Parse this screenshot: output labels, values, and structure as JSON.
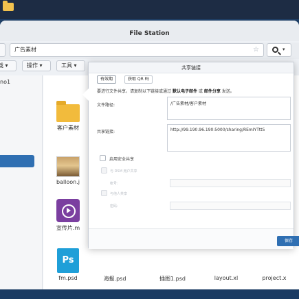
{
  "window": {
    "title": "File Station"
  },
  "pathbar": {
    "path": "广告素材"
  },
  "toolbar": {
    "btn1": "载 ▾",
    "btn2": "操作 ▾",
    "btn3": "工具 ▾"
  },
  "sidebar": {
    "label": "no1"
  },
  "files": [
    {
      "name": "客户素材",
      "kind": "folder"
    },
    {
      "name": "balloon.j",
      "kind": "photo"
    },
    {
      "name": "宣传片.m",
      "kind": "video"
    },
    {
      "name": "fm.psd",
      "kind": "psd"
    },
    {
      "name": "海报.psd",
      "kind": "psd"
    },
    {
      "name": "插图1.psd",
      "kind": "psd"
    },
    {
      "name": "layout.xl",
      "kind": "sheet"
    },
    {
      "name": "project.x",
      "kind": "sheet"
    }
  ],
  "icons": {
    "psd_glyph": "Ps",
    "star": "☆",
    "search_caret": "▾"
  },
  "dialog": {
    "title": "共享链接",
    "tab_valid": "有效期",
    "tab_qr": "获取 QR 码",
    "hint_pre": "要进行文件共享，请复制以下链接或通过",
    "hint_link1": "默认电子邮件",
    "hint_mid": "或",
    "hint_link2": "邮件分享",
    "hint_post": "发送。",
    "path_label": "文件路径:",
    "path_value": "/广告素材/客户素材",
    "link_label": "共享链接:",
    "link_value": "http://99.190.96.190:5000/sharing/REmIYTtt5",
    "secure_label": "启用安全共享",
    "opt_dsm": "与 DSM 用户共享",
    "opt_dsm_field": "帐号:",
    "opt_anyone": "与他人共享",
    "opt_anyone_field": "密码:",
    "save": "保存"
  },
  "colors": {
    "accent": "#2f6fb2",
    "folder": "#f2bb3c",
    "ps": "#1f9fd8"
  }
}
